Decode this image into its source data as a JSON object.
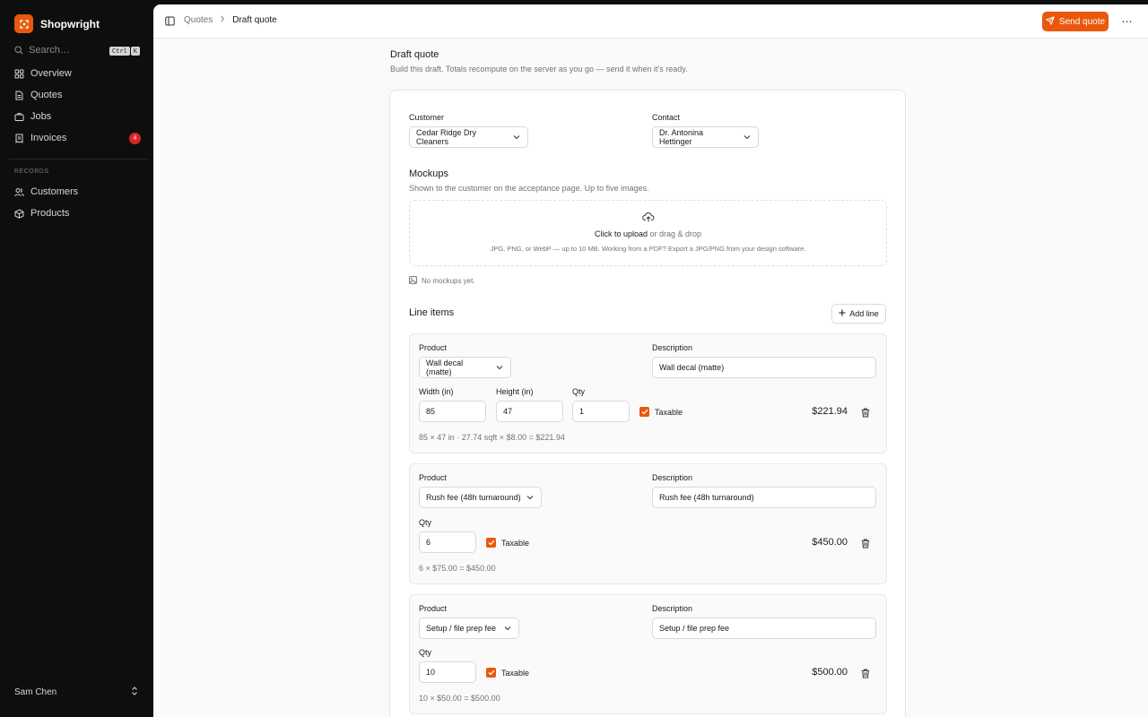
{
  "app": {
    "name": "Shopwright",
    "accent": "#ea580c"
  },
  "search": {
    "placeholder": "Search…",
    "shortcut_mod": "Ctrl",
    "shortcut_key": "K"
  },
  "sidebar": {
    "items": [
      {
        "label": "Overview",
        "icon": "layout-grid-icon"
      },
      {
        "label": "Quotes",
        "icon": "file-text-icon"
      },
      {
        "label": "Jobs",
        "icon": "briefcase-icon"
      },
      {
        "label": "Invoices",
        "icon": "receipt-icon",
        "badge": "4"
      }
    ],
    "section_label": "RECORDS",
    "records": [
      {
        "label": "Customers",
        "icon": "users-icon"
      },
      {
        "label": "Products",
        "icon": "package-icon"
      }
    ],
    "user": {
      "name": "Sam Chen"
    }
  },
  "breadcrumb": {
    "parent": "Quotes",
    "current": "Draft quote"
  },
  "header": {
    "send_label": "Send quote",
    "more_label": "⋯"
  },
  "page": {
    "title": "Draft quote",
    "subtitle": "Build this draft. Totals recompute on the server as you go — send it when it's ready."
  },
  "form": {
    "customer_label": "Customer",
    "customer_value": "Cedar Ridge Dry Cleaners",
    "contact_label": "Contact",
    "contact_value": "Dr. Antonina Hettinger"
  },
  "mockups": {
    "title": "Mockups",
    "subtitle": "Shown to the customer on the acceptance page. Up to five images.",
    "upload_action": "Click to upload",
    "upload_rest": " or drag & drop",
    "hint": "JPG, PNG, or WebP — up to 10 MB. Working from a PDF? Export a JPG/PNG from your design software.",
    "empty": "No mockups yet."
  },
  "line_items": {
    "title": "Line items",
    "add_label": "Add line",
    "labels": {
      "product": "Product",
      "description": "Description",
      "width": "Width (in)",
      "height": "Height (in)",
      "qty": "Qty",
      "taxable": "Taxable"
    },
    "lines": [
      {
        "product": "Wall decal (matte)",
        "description": "Wall decal (matte)",
        "width": "85",
        "height": "47",
        "qty": "1",
        "taxable": true,
        "amount": "$221.94",
        "calc": "85 × 47 in · 27.74 sqft × $8.00 = $221.94"
      },
      {
        "product": "Rush fee (48h turnaround)",
        "description": "Rush fee (48h turnaround)",
        "qty": "6",
        "taxable": true,
        "amount": "$450.00",
        "calc": "6 × $75.00 = $450.00"
      },
      {
        "product": "Setup / file prep fee",
        "description": "Setup / file prep fee",
        "qty": "10",
        "taxable": true,
        "amount": "$500.00",
        "calc": "10 × $50.00 = $500.00"
      }
    ]
  }
}
